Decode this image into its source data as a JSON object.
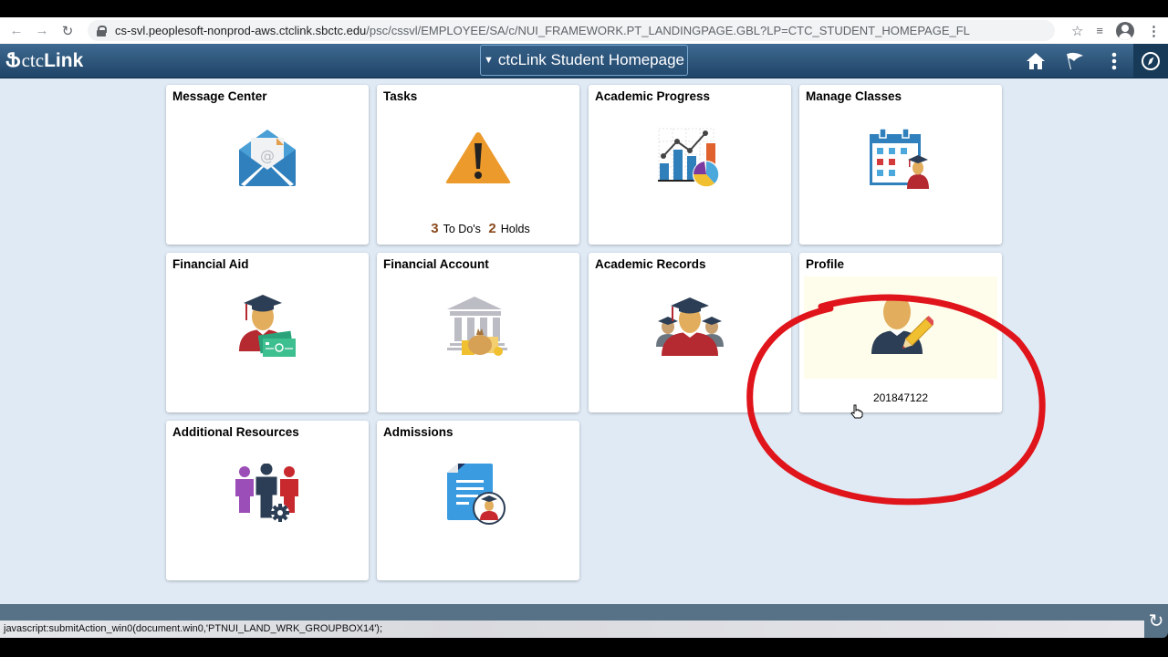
{
  "browser": {
    "url_host": "cs-svl.peoplesoft-nonprod-aws.ctclink.sbctc.edu",
    "url_path": "/psc/cssvl/EMPLOYEE/SA/c/NUI_FRAMEWORK.PT_LANDINGPAGE.GBL?LP=CTC_STUDENT_HOMEPAGE_FL",
    "icons": [
      "back-icon",
      "forward-icon",
      "reload-icon",
      "lock-icon",
      "star-icon",
      "media-queue-icon",
      "profile-avatar-icon",
      "more-menu-icon"
    ]
  },
  "header": {
    "logo_prefix": "ctc",
    "logo_suffix": "Link",
    "homepage_selector": "ctcLink Student Homepage",
    "icons": [
      "home-icon",
      "flag-icon",
      "actions-menu-icon",
      "navbar-compass-icon"
    ]
  },
  "tiles": [
    {
      "title": "Message Center",
      "icon": "envelope-icon"
    },
    {
      "title": "Tasks",
      "icon": "warning-icon",
      "todos_count": "3",
      "todos_label": "To Do's",
      "holds_count": "2",
      "holds_label": "Holds"
    },
    {
      "title": "Academic Progress",
      "icon": "chart-icon"
    },
    {
      "title": "Manage Classes",
      "icon": "calendar-student-icon"
    },
    {
      "title": "Financial Aid",
      "icon": "graduate-money-icon"
    },
    {
      "title": "Financial Account",
      "icon": "bank-icon"
    },
    {
      "title": "Academic Records",
      "icon": "graduates-icon"
    },
    {
      "title": "Profile",
      "icon": "profile-edit-icon",
      "student_id": "201847122"
    },
    {
      "title": "Additional Resources",
      "icon": "people-gear-icon"
    },
    {
      "title": "Admissions",
      "icon": "document-student-icon"
    }
  ],
  "status_bar": {
    "text": "javascript:submitAction_win0(document.win0,'PTNUI_LAND_WRK_GROUPBOX14');"
  },
  "colors": {
    "header_top": "#3f6a91",
    "header_bottom": "#1f4567",
    "content_bg": "#dfeaf5",
    "annotation_red": "#e0141b",
    "tasks_count": "#8a4a1d"
  }
}
